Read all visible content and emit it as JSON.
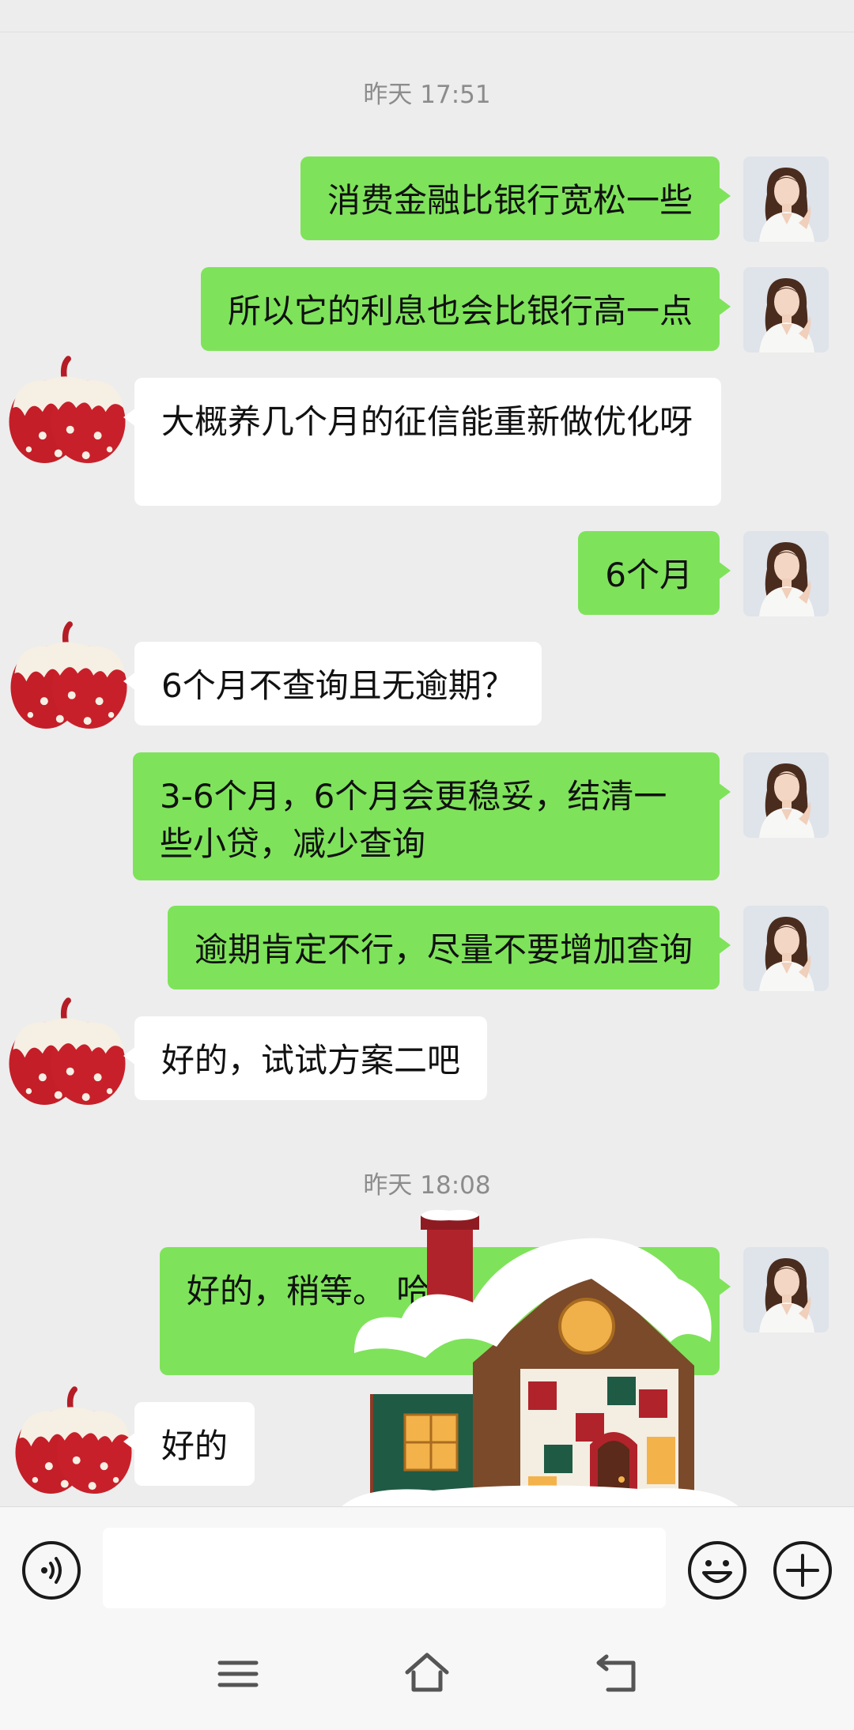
{
  "timestamps": [
    "昨天 17:51",
    "昨天 18:08"
  ],
  "messages": [
    {
      "side": "me",
      "text": "消费金融比银行宽松一些"
    },
    {
      "side": "me",
      "text": "所以它的利息也会比银行高一点"
    },
    {
      "side": "them",
      "text": "大概养几个月的征信能重新做优化呀"
    },
    {
      "side": "me",
      "text": "6个月"
    },
    {
      "side": "them",
      "text": "6个月不查询且无逾期？"
    },
    {
      "side": "me",
      "text": "3-6个月，6个月会更稳妥，结清一些小贷，减少查询"
    },
    {
      "side": "me",
      "text": "逾期肯定不行，尽量不要增加查询"
    },
    {
      "side": "them",
      "text": "好的，试试方案二吧"
    },
    {
      "side": "me",
      "text": "好的，稍等。 哈。"
    },
    {
      "side": "them",
      "text": "好的"
    }
  ],
  "avatars": {
    "me": "woman-portrait-avatar",
    "them": "strawberry-apple-avatar"
  },
  "sticker": "snowy-gingerbread-house-sticker",
  "input": {
    "value": "",
    "placeholder": ""
  },
  "icons": {
    "voice": "voice-icon",
    "emoji": "emoji-icon",
    "plus": "plus-icon",
    "menu": "menu-icon",
    "home": "home-icon",
    "back": "back-icon"
  },
  "colors": {
    "background": "#ededed",
    "my_bubble": "#7ee35a",
    "their_bubble": "#ffffff",
    "timestamp": "#8c8c8c"
  }
}
